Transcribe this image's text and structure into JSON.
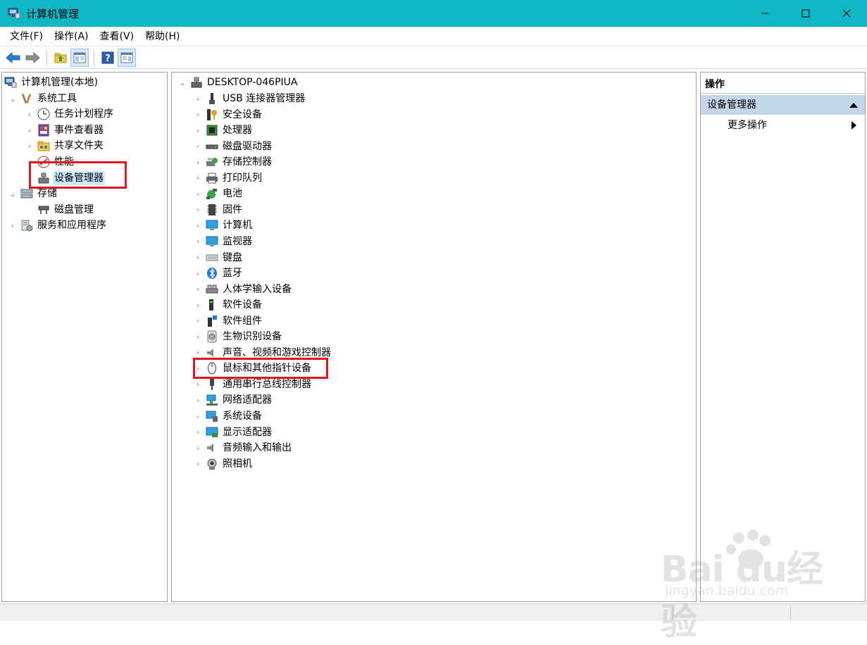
{
  "window": {
    "title": "计算机管理",
    "controls": [
      "minimize",
      "maximize",
      "close"
    ]
  },
  "menu": [
    "文件(F)",
    "操作(A)",
    "查看(V)",
    "帮助(H)"
  ],
  "left_tree": {
    "root": "计算机管理(本地)",
    "system_tools": "系统工具",
    "task_scheduler": "任务计划程序",
    "event_viewer": "事件查看器",
    "shared_folders": "共享文件夹",
    "performance": "性能",
    "device_manager": "设备管理器",
    "storage": "存储",
    "disk_management": "磁盘管理",
    "services_apps": "服务和应用程序"
  },
  "device_tree": {
    "computer": "DESKTOP-046PIUA",
    "categories": [
      {
        "label": "USB 连接器管理器",
        "icon": "usb-icon"
      },
      {
        "label": "安全设备",
        "icon": "security-key-icon"
      },
      {
        "label": "处理器",
        "icon": "processor-icon"
      },
      {
        "label": "磁盘驱动器",
        "icon": "disk-drive-icon"
      },
      {
        "label": "存储控制器",
        "icon": "storage-controller-icon"
      },
      {
        "label": "打印队列",
        "icon": "printer-icon"
      },
      {
        "label": "电池",
        "icon": "battery-icon"
      },
      {
        "label": "固件",
        "icon": "firmware-icon"
      },
      {
        "label": "计算机",
        "icon": "computer-icon"
      },
      {
        "label": "监视器",
        "icon": "monitor-icon"
      },
      {
        "label": "键盘",
        "icon": "keyboard-icon"
      },
      {
        "label": "蓝牙",
        "icon": "bluetooth-icon"
      },
      {
        "label": "人体学输入设备",
        "icon": "hid-icon"
      },
      {
        "label": "软件设备",
        "icon": "software-device-icon"
      },
      {
        "label": "软件组件",
        "icon": "software-component-icon"
      },
      {
        "label": "生物识别设备",
        "icon": "fingerprint-icon"
      },
      {
        "label": "声音、视频和游戏控制器",
        "icon": "speaker-icon"
      },
      {
        "label": "鼠标和其他指针设备",
        "icon": "mouse-icon"
      },
      {
        "label": "通用串行总线控制器",
        "icon": "usb-controller-icon"
      },
      {
        "label": "网络适配器",
        "icon": "network-adapter-icon"
      },
      {
        "label": "系统设备",
        "icon": "system-device-icon"
      },
      {
        "label": "显示适配器",
        "icon": "display-adapter-icon"
      },
      {
        "label": "音频输入和输出",
        "icon": "audio-io-icon"
      },
      {
        "label": "照相机",
        "icon": "camera-icon"
      }
    ]
  },
  "actions": {
    "header": "操作",
    "group": "设备管理器",
    "more": "更多操作"
  },
  "watermark": {
    "brand_logo": "Baidu经验",
    "url": "jingyan.baidu.com"
  },
  "colors": {
    "titlebar": "#0fb6c4",
    "selection": "#cce8ff",
    "actions_group": "#c4d7ea",
    "highlight": "#e0151e"
  }
}
